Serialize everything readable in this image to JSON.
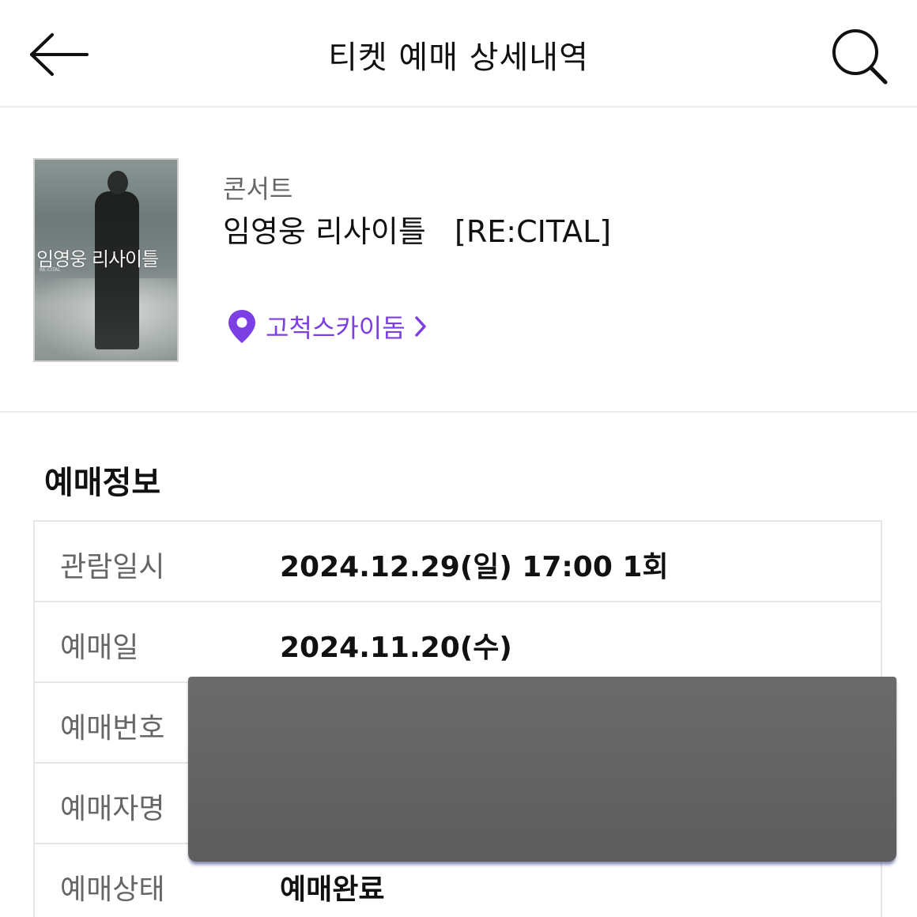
{
  "header": {
    "title": "티켓 예매 상세내역"
  },
  "event": {
    "category": "콘서트",
    "title": "임영웅 리사이틀   [RE:CITAL]",
    "venue": "고척스카이돔",
    "poster": {
      "title_text": "임영웅 리사이틀",
      "subtitle_text": "RE:CITAL"
    }
  },
  "reservation": {
    "section_title": "예매정보",
    "rows": [
      {
        "label": "관람일시",
        "value": "2024.12.29(일) 17:00 1회"
      },
      {
        "label": "예매일",
        "value": "2024.11.20(수)"
      },
      {
        "label": "예매번호",
        "value": ""
      },
      {
        "label": "예매자명",
        "value": ""
      },
      {
        "label": "예매상태",
        "value": "예매완료"
      }
    ]
  },
  "colors": {
    "accent": "#7b3fe4",
    "redaction": "#636363"
  },
  "icons": {
    "back": "arrow-left-icon",
    "search": "search-icon",
    "location": "location-pin-icon",
    "chevron": "chevron-right-icon"
  }
}
